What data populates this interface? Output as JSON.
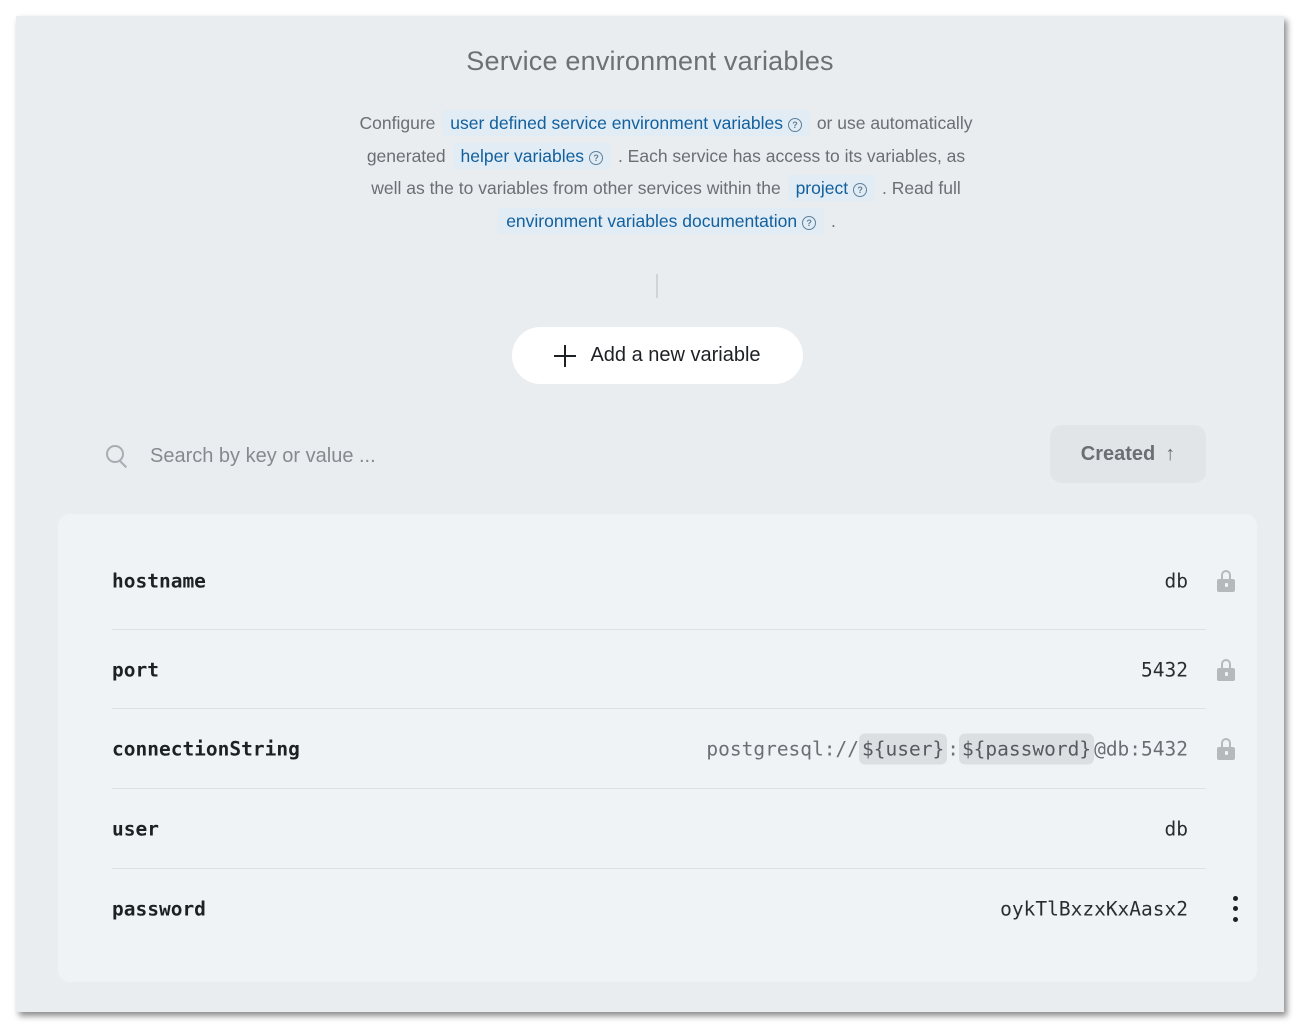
{
  "header": {
    "title": "Service environment variables"
  },
  "description": {
    "t1": "Configure",
    "link1": "user defined service environment variables",
    "t2": "or use automatically generated",
    "link2": "helper variables",
    "t3": ". Each service has access to its variables, as well as the to variables from other services within the",
    "link3": "project",
    "t4": ". Read full",
    "link4": "environment variables documentation",
    "t5": "."
  },
  "add_button": {
    "label": "Add a new variable"
  },
  "search": {
    "placeholder": "Search by key or value ..."
  },
  "sort": {
    "label": "Created",
    "direction": "ascending"
  },
  "variables": [
    {
      "key": "hostname",
      "value": "db",
      "locked": true
    },
    {
      "key": "port",
      "value": "5432",
      "locked": true
    },
    {
      "key": "connectionString",
      "value_parts": {
        "prefix": "postgresql://",
        "ref1": "${user}",
        "sep": ":",
        "ref2": "${password}",
        "suffix": "@db:5432"
      },
      "locked": true
    },
    {
      "key": "user",
      "value": "db",
      "locked": false
    },
    {
      "key": "password",
      "value": "oykTlBxzxKxAasx2",
      "locked": false
    }
  ],
  "colors": {
    "panel_bg": "#e9edf0",
    "link": "#12609e",
    "link_bg": "#e1ecf4",
    "table_bg": "#f0f3f6"
  }
}
